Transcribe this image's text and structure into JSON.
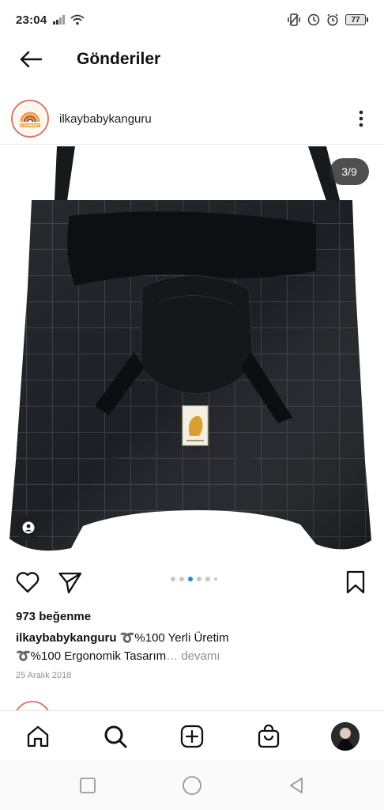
{
  "status_bar": {
    "time": "23:04",
    "battery": "77"
  },
  "header": {
    "title": "Gönderiler"
  },
  "post": {
    "username": "ilkaybabykanguru",
    "avatar_brand": "İLKAYBABY",
    "image_counter": "3/9",
    "likes": "973 beğenme",
    "caption_line1": "➰%100 Yerli Üretim",
    "caption_line2": "➰%100 Ergonomik Tasarım",
    "more_label": "devamı",
    "date": "25 Aralık 2018",
    "carousel": {
      "count": 5,
      "active": 2
    }
  },
  "icons": {
    "back": "arrow-left-icon",
    "more": "more-vertical-icon",
    "like": "heart-icon",
    "share": "send-icon",
    "save": "bookmark-icon",
    "tag": "user-tag-icon",
    "home": "home-icon",
    "search": "search-icon",
    "add": "add-post-icon",
    "shop": "shopping-bag-icon"
  },
  "colors": {
    "accent_dot": "#1e88e5",
    "avatar_ring": "#e07a6a",
    "product": "#1b1d22"
  }
}
